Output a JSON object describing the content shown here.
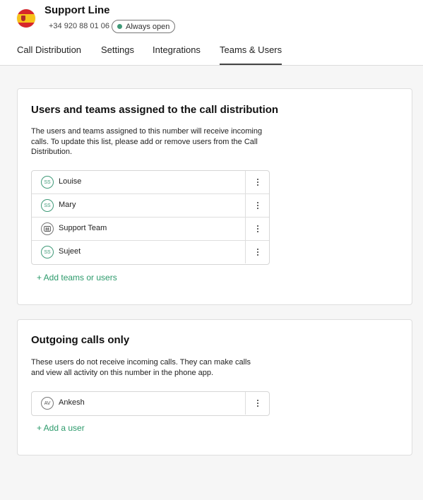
{
  "header": {
    "title": "Support Line",
    "phone": "+34 920 88 01 06",
    "status": "Always open",
    "flag_icon": "spain-flag-icon"
  },
  "tabs": [
    {
      "label": "Call Distribution",
      "active": false
    },
    {
      "label": "Settings",
      "active": false
    },
    {
      "label": "Integrations",
      "active": false
    },
    {
      "label": "Teams & Users",
      "active": true
    }
  ],
  "assigned": {
    "title": "Users and teams assigned to the call distribution",
    "description": "The users and teams assigned to this number will receive incoming calls. To update this list, please add or remove users from the Call Distribution.",
    "rows": [
      {
        "initials": "SS",
        "label": "Louise",
        "type": "user"
      },
      {
        "initials": "SS",
        "label": "Mary",
        "type": "user"
      },
      {
        "initials": "",
        "label": "Support Team",
        "type": "team"
      },
      {
        "initials": "SS",
        "label": "Sujeet",
        "type": "user"
      }
    ],
    "add_label": "+ Add teams or users"
  },
  "outgoing": {
    "title": "Outgoing calls only",
    "description": "These users do not receive incoming calls. They can make calls and view all activity on this number in the phone app.",
    "rows": [
      {
        "initials": "AV",
        "label": "Ankesh",
        "type": "user"
      }
    ],
    "add_label": "+ Add a user"
  },
  "colors": {
    "accent": "#2c9a6b",
    "status_dot": "#3f9a78",
    "background": "#f6f6f6"
  }
}
